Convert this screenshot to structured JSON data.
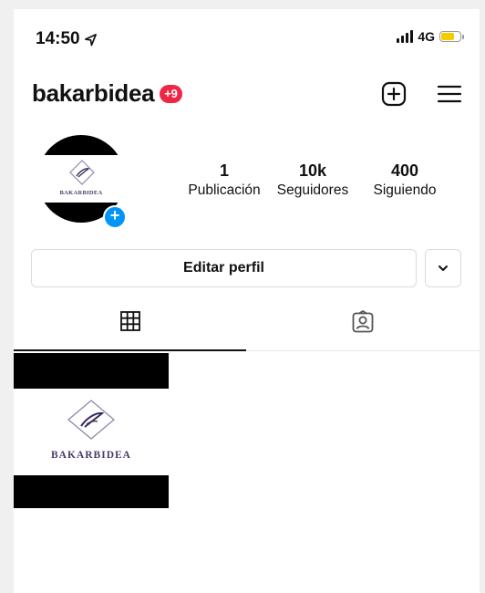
{
  "status_bar": {
    "time": "14:50",
    "network": "4G",
    "battery_color": "#f5cc00"
  },
  "header": {
    "username": "bakarbidea",
    "notification_badge": "+9",
    "icons": [
      "new-post-icon",
      "menu-icon"
    ]
  },
  "profile": {
    "avatar_logo_text": "BAKARBIDEA",
    "add_story_symbol": "+",
    "stats": [
      {
        "value": "1",
        "label": "Publicación"
      },
      {
        "value": "10k",
        "label": "Seguidores"
      },
      {
        "value": "400",
        "label": "Siguiendo"
      }
    ]
  },
  "actions": {
    "edit_label": "Editar perfil",
    "more_icon": "chevron-down-icon"
  },
  "tabs": [
    {
      "icon": "grid-icon",
      "active": true
    },
    {
      "icon": "tagged-icon",
      "active": false
    }
  ],
  "posts": [
    {
      "logo_text": "BAKARBIDEA"
    }
  ],
  "colors": {
    "badge": "#ed2744",
    "accent_blue": "#0095f6"
  }
}
